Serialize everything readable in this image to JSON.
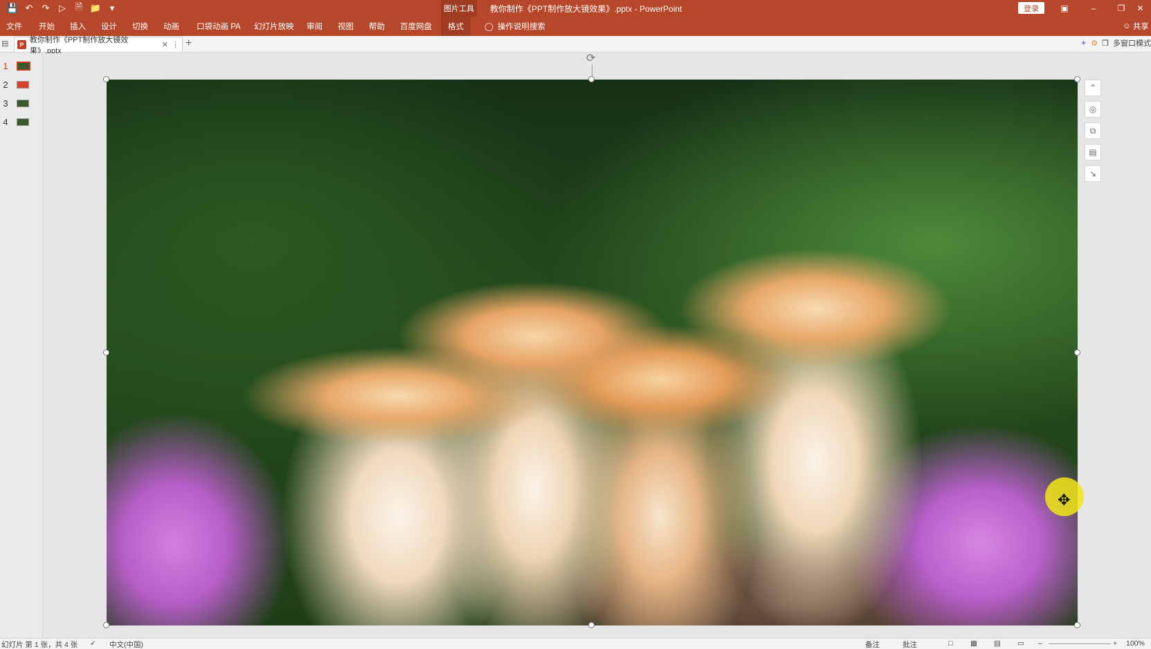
{
  "titlebar": {
    "context_tools": "图片工具",
    "document_title": "教你制作《PPT制作放大镜效果》.pptx  -  PowerPoint",
    "login_label": "登录"
  },
  "ribbon": {
    "tabs": [
      "文件",
      "开始",
      "插入",
      "设计",
      "切换",
      "动画",
      "口袋动画 PA",
      "幻灯片放映",
      "审阅",
      "视图",
      "帮助",
      "百度网盘",
      "格式"
    ],
    "active_tab": "格式",
    "tell_me": "操作说明搜索",
    "share": "共享"
  },
  "doc_tab": {
    "label": "教你制作《PPT制作放大镜效果》.pptx",
    "multi_window": "多窗口模式"
  },
  "thumbnails": [
    {
      "number": "1",
      "active": true
    },
    {
      "number": "2",
      "active": false
    },
    {
      "number": "3",
      "active": false
    },
    {
      "number": "4",
      "active": false
    }
  ],
  "status": {
    "slide_info": "幻灯片 第 1 张，共 4 张",
    "language": "中文(中国)",
    "notes": "备注",
    "comments": "批注",
    "zoom": "100%"
  },
  "colors": {
    "accent": "#b7472a",
    "accent_dark": "#a03c22"
  }
}
